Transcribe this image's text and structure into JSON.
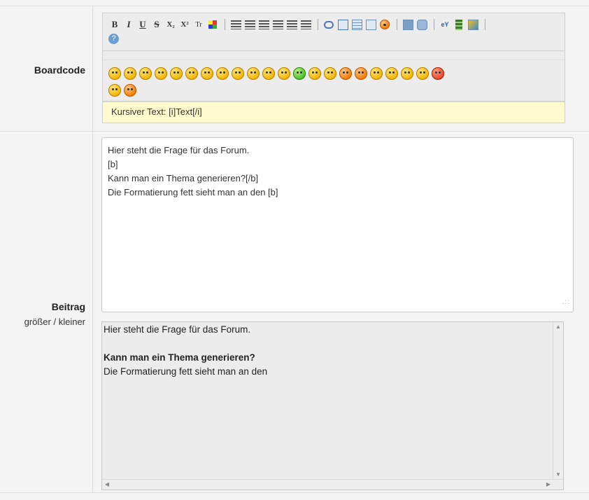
{
  "rows": {
    "boardcode_label": "Boardcode",
    "beitrag_label": "Beitrag",
    "resize_bigger": "größer",
    "resize_sep": " / ",
    "resize_smaller": "kleiner"
  },
  "toolbar": {
    "bold": "B",
    "italic": "I",
    "underline": "U",
    "strike": "S",
    "subscript": "X₂",
    "superscript": "X²",
    "teletype": "Tr",
    "help": "?"
  },
  "hint_text": "Kursiver Text: [i]Text[/i]",
  "editor_lines": [
    "Hier steht die Frage für das Forum.",
    "[b]",
    "Kann man ein Thema generieren?[/b]",
    "Die Formatierung fett sieht man an den [b]"
  ],
  "preview": {
    "line1": "Hier steht die Frage für das Forum.",
    "line2": "",
    "line3": "Kann man ein Thema generieren?",
    "line4": "Die Formatierung fett sieht man an den"
  }
}
